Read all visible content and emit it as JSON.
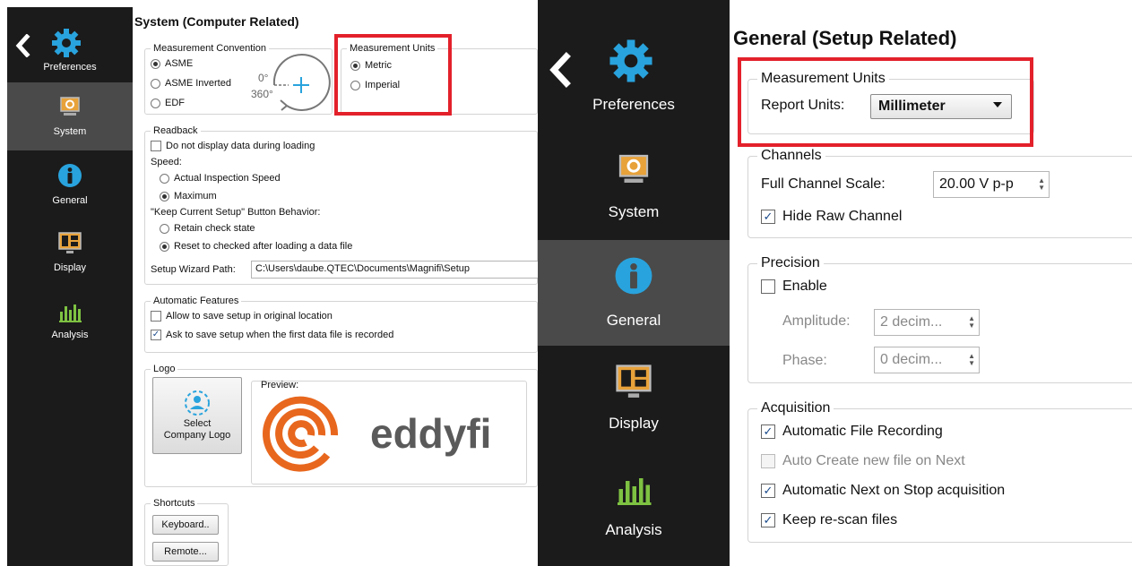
{
  "left": {
    "sidebar": {
      "items": [
        {
          "label": "Preferences",
          "icon": "gear-icon"
        },
        {
          "label": "System",
          "icon": "system-icon"
        },
        {
          "label": "General",
          "icon": "info-icon"
        },
        {
          "label": "Display",
          "icon": "display-icon"
        },
        {
          "label": "Analysis",
          "icon": "analysis-icon"
        }
      ]
    },
    "title": "System (Computer Related)",
    "convention": {
      "label": "Measurement Convention",
      "options": [
        "ASME",
        "ASME Inverted",
        "EDF"
      ],
      "selected": "ASME",
      "diagram": {
        "zero": "0°",
        "full": "360°"
      }
    },
    "units": {
      "label": "Measurement Units",
      "options": [
        "Metric",
        "Imperial"
      ],
      "selected": "Metric"
    },
    "readback": {
      "label": "Readback",
      "no_display": "Do not display data during loading",
      "speed_label": "Speed:",
      "speed_options": [
        "Actual Inspection Speed",
        "Maximum"
      ],
      "speed_selected": "Maximum",
      "keep_label": "\"Keep Current Setup\" Button Behavior:",
      "keep_options": [
        "Retain check state",
        "Reset to checked after loading a data file"
      ],
      "keep_selected": "Reset to checked after loading a data file",
      "wizard_label": "Setup Wizard Path:",
      "wizard_path": "C:\\Users\\daube.QTEC\\Documents\\Magnifi\\Setup"
    },
    "auto": {
      "label": "Automatic Features",
      "items": [
        {
          "label": "Allow to save setup in original location",
          "checked": false
        },
        {
          "label": "Ask to save setup when the first data file is recorded",
          "checked": true
        }
      ]
    },
    "logo": {
      "label": "Logo",
      "select_button": "Select\nCompany Logo",
      "preview_label": "Preview:",
      "brand": "eddyfi"
    },
    "shortcuts": {
      "label": "Shortcuts",
      "keyboard": "Keyboard..",
      "remote": "Remote..."
    }
  },
  "right": {
    "sidebar": {
      "items": [
        {
          "label": "Preferences",
          "icon": "gear-icon"
        },
        {
          "label": "System",
          "icon": "system-icon"
        },
        {
          "label": "General",
          "icon": "info-icon"
        },
        {
          "label": "Display",
          "icon": "display-icon"
        },
        {
          "label": "Analysis",
          "icon": "analysis-icon"
        }
      ]
    },
    "title": "General (Setup Related)",
    "units": {
      "label": "Measurement Units",
      "report_label": "Report Units:",
      "report_value": "Millimeter"
    },
    "channels": {
      "label": "Channels",
      "scale_label": "Full Channel Scale:",
      "scale_value": "20.00 V p-p",
      "hide_raw": "Hide Raw Channel",
      "hide_raw_checked": true
    },
    "precision": {
      "label": "Precision",
      "enable": "Enable",
      "enable_checked": false,
      "amplitude_label": "Amplitude:",
      "amplitude_value": "2 decim...",
      "phase_label": "Phase:",
      "phase_value": "0 decim..."
    },
    "acquisition": {
      "label": "Acquisition",
      "items": [
        {
          "label": "Automatic File Recording",
          "checked": true,
          "enabled": true
        },
        {
          "label": "Auto Create new file on Next",
          "checked": false,
          "enabled": false
        },
        {
          "label": "Automatic Next on Stop acquisition",
          "checked": true,
          "enabled": true
        },
        {
          "label": "Keep re-scan files",
          "checked": true,
          "enabled": true
        }
      ]
    }
  },
  "colors": {
    "sidebar_bg": "#1b1b1b",
    "sidebar_active": "#4a4a4a",
    "accent_blue": "#29a3dd",
    "highlight_red": "#e3212b",
    "logo_orange": "#e8671e",
    "logo_gray": "#5a5a5a"
  }
}
